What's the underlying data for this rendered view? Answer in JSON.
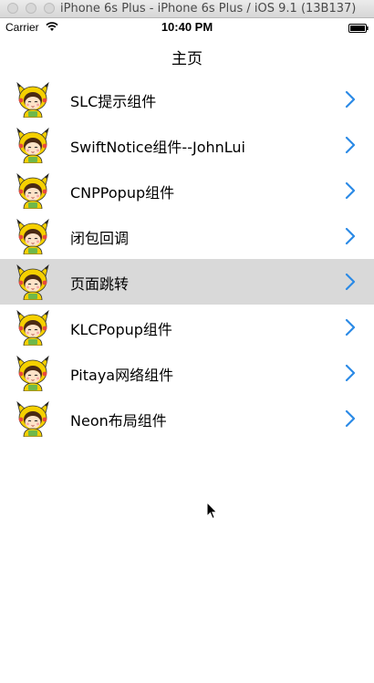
{
  "window": {
    "title": "iPhone 6s Plus - iPhone 6s Plus / iOS 9.1 (13B137)"
  },
  "statusbar": {
    "carrier": "Carrier",
    "time": "10:40 PM"
  },
  "navbar": {
    "title": "主页"
  },
  "list": {
    "items": [
      {
        "label": "SLC提示组件",
        "avatar": "pikachu-girl-avatar"
      },
      {
        "label": "SwiftNotice组件--JohnLui",
        "avatar": "pikachu-girl-avatar"
      },
      {
        "label": "CNPPopup组件",
        "avatar": "pikachu-girl-avatar"
      },
      {
        "label": "闭包回调",
        "avatar": "pikachu-girl-avatar"
      },
      {
        "label": "页面跳转",
        "avatar": "pikachu-girl-avatar",
        "selected": true
      },
      {
        "label": "KLCPopup组件",
        "avatar": "pikachu-girl-avatar"
      },
      {
        "label": "Pitaya网络组件",
        "avatar": "pikachu-girl-avatar"
      },
      {
        "label": "Neon布局组件",
        "avatar": "pikachu-girl-avatar"
      }
    ]
  },
  "colors": {
    "accent": "#2b8ae6",
    "selected_row": "#d9d9d9",
    "avatar_yellow": "#f5d000"
  }
}
